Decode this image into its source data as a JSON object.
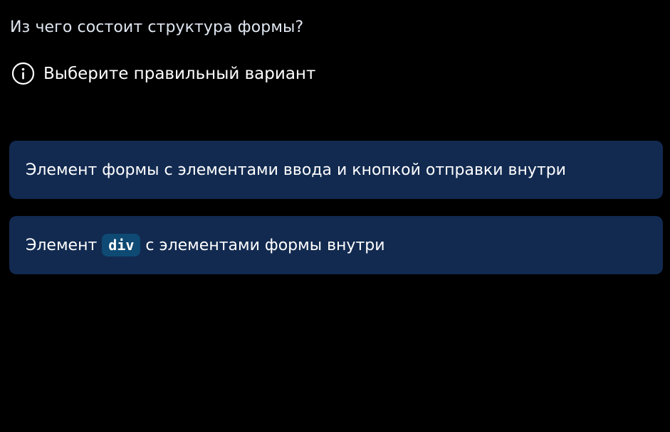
{
  "question": {
    "title": "Из чего состоит структура формы?"
  },
  "hint": {
    "icon": "info-icon",
    "text": "Выберите правильный вариант"
  },
  "options": [
    {
      "text": "Элемент формы с элементами ввода и кнопкой отправки внутри"
    },
    {
      "prefix": "Элемент",
      "code": "div",
      "suffix": "с элементами формы внутри"
    }
  ],
  "colors": {
    "background": "#000000",
    "option_background": "#122a50",
    "code_chip_background": "#0e4a73",
    "text": "#ffffff"
  }
}
